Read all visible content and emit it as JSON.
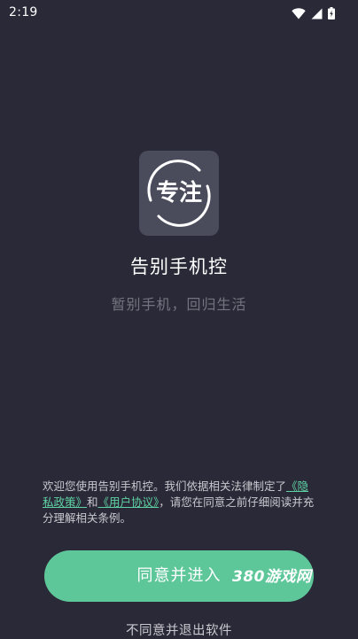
{
  "status_bar": {
    "time": "2:19",
    "icons": [
      "wifi-icon",
      "signal-icon",
      "battery-icon"
    ]
  },
  "app": {
    "icon_text": "专注",
    "name": "告别手机控",
    "slogan": "暂别手机，回归生活"
  },
  "notice": {
    "text_before": "欢迎您使用告别手机控。我们依据相关法律制定了",
    "privacy_link": "《隐私政策》",
    "and": "和",
    "user_link": "《用户协议》",
    "text_after": "，请您在同意之前仔细阅读并充分理解相关条例。"
  },
  "actions": {
    "agree_label": "同意并进入",
    "decline_label": "不同意并退出软件"
  },
  "watermark": "380游戏网",
  "colors": {
    "background": "#2a2937",
    "accent": "#5ec79a",
    "link": "#5fd3a3",
    "icon_bg": "#4a4c5b"
  }
}
